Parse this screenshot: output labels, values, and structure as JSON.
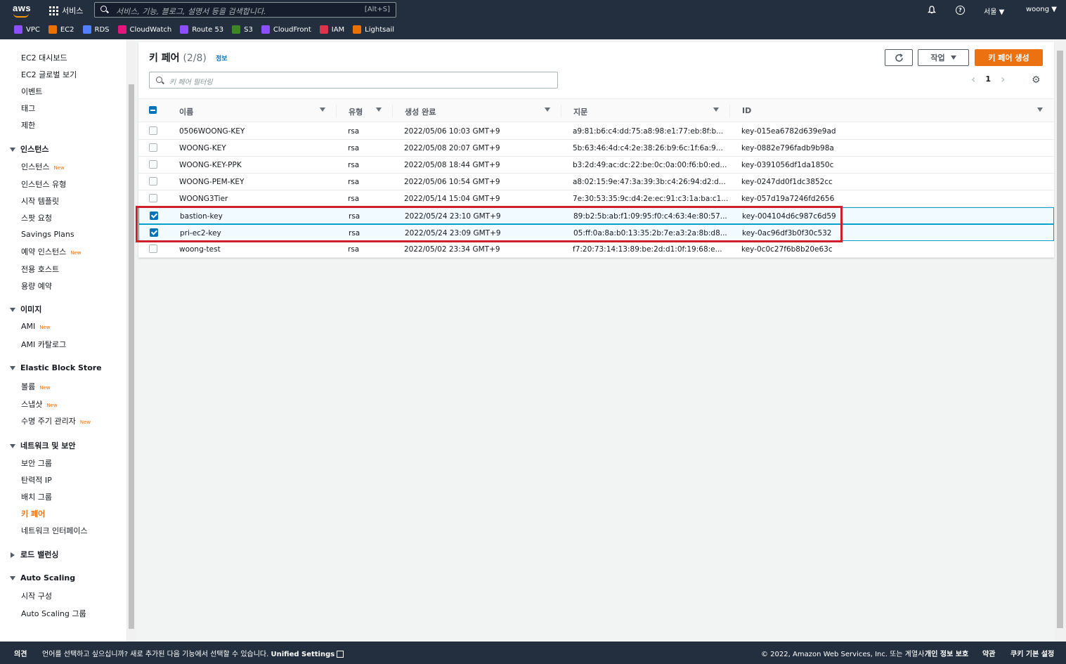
{
  "topnav": {
    "logo": "aws",
    "services_label": "서비스",
    "search_placeholder": "서비스, 기능, 블로그, 설명서 등을 검색합니다.",
    "search_shortcut": "[Alt+S]",
    "region": "서울 ▼",
    "user": "woong ▼"
  },
  "favorites": [
    {
      "label": "VPC",
      "color": "#8c4fff"
    },
    {
      "label": "EC2",
      "color": "#ed7100"
    },
    {
      "label": "RDS",
      "color": "#527fff"
    },
    {
      "label": "CloudWatch",
      "color": "#e7157b"
    },
    {
      "label": "Route 53",
      "color": "#8c4fff"
    },
    {
      "label": "S3",
      "color": "#3f8624"
    },
    {
      "label": "CloudFront",
      "color": "#8c4fff"
    },
    {
      "label": "IAM",
      "color": "#dd344c"
    },
    {
      "label": "Lightsail",
      "color": "#ed7100"
    }
  ],
  "sidebar": {
    "items_top": [
      "EC2 대시보드",
      "EC2 글로벌 보기",
      "이벤트",
      "태그",
      "제한"
    ],
    "instances": {
      "title": "인스턴스",
      "items": [
        {
          "label": "인스턴스",
          "new": "New"
        },
        {
          "label": "인스턴스 유형",
          "new": ""
        },
        {
          "label": "시작 템플릿",
          "new": ""
        },
        {
          "label": "스팟 요청",
          "new": ""
        },
        {
          "label": "Savings Plans",
          "new": ""
        },
        {
          "label": "예약 인스턴스",
          "new": "New"
        },
        {
          "label": "전용 호스트",
          "new": ""
        },
        {
          "label": "용량 예약",
          "new": ""
        }
      ]
    },
    "images": {
      "title": "이미지",
      "items": [
        {
          "label": "AMI",
          "new": "New"
        },
        {
          "label": "AMI 카탈로그",
          "new": ""
        }
      ]
    },
    "ebs": {
      "title": "Elastic Block Store",
      "items": [
        {
          "label": "볼륨",
          "new": "New"
        },
        {
          "label": "스냅샷",
          "new": "New"
        },
        {
          "label": "수명 주기 관리자",
          "new": "New"
        }
      ]
    },
    "network": {
      "title": "네트워크 및 보안",
      "items": [
        {
          "label": "보안 그룹"
        },
        {
          "label": "탄력적 IP"
        },
        {
          "label": "배치 그룹"
        },
        {
          "label": "키 페어"
        },
        {
          "label": "네트워크 인터페이스"
        }
      ]
    },
    "lb": {
      "title": "로드 밸런싱"
    },
    "asg": {
      "title": "Auto Scaling",
      "items": [
        {
          "label": "시작 구성"
        },
        {
          "label": "Auto Scaling 그룹"
        }
      ]
    }
  },
  "panel": {
    "title": "키 페어",
    "count": "(2/8)",
    "info": "정보",
    "action_label": "작업",
    "create_label": "키 페어 생성",
    "filter_placeholder": "키 페어 필터링",
    "page": "1"
  },
  "table": {
    "headers": [
      "이름",
      "유형",
      "생성 완료",
      "지문",
      "ID"
    ],
    "rows": [
      {
        "name": "0506WOONG-KEY",
        "type": "rsa",
        "created": "2022/05/06 10:03 GMT+9",
        "fingerprint": "a9:81:b6:c4:dd:75:a8:98:e1:77:eb:8f:b...",
        "id": "key-015ea6782d639e9ad",
        "selected": false
      },
      {
        "name": "WOONG-KEY",
        "type": "rsa",
        "created": "2022/05/08 20:07 GMT+9",
        "fingerprint": "5b:63:46:4d:c4:2e:38:26:b9:6c:1f:6a:9...",
        "id": "key-0882e796fadb9b98a",
        "selected": false
      },
      {
        "name": "WOONG-KEY-PPK",
        "type": "rsa",
        "created": "2022/05/08 18:44 GMT+9",
        "fingerprint": "b3:2d:49:ac:dc:22:be:0c:0a:00:f6:b0:ed...",
        "id": "key-0391056df1da1850c",
        "selected": false
      },
      {
        "name": "WOONG-PEM-KEY",
        "type": "rsa",
        "created": "2022/05/06 10:54 GMT+9",
        "fingerprint": "a8:02:15:9e:47:3a:39:3b:c4:26:94:d2:d...",
        "id": "key-0247dd0f1dc3852cc",
        "selected": false
      },
      {
        "name": "WOONG3Tier",
        "type": "rsa",
        "created": "2022/05/14 15:04 GMT+9",
        "fingerprint": "7e:30:53:35:9c:d4:2e:ec:91:c3:1a:ba:c1...",
        "id": "key-057d19a7246fd2656",
        "selected": false
      },
      {
        "name": "bastion-key",
        "type": "rsa",
        "created": "2022/05/24 23:10 GMT+9",
        "fingerprint": "89:b2:5b:ab:f1:09:95:f0:c4:63:4e:80:57...",
        "id": "key-004104d6c987c6d59",
        "selected": true
      },
      {
        "name": "pri-ec2-key",
        "type": "rsa",
        "created": "2022/05/24 23:09 GMT+9",
        "fingerprint": "05:ff:0a:8a:b0:13:35:2b:7e:a3:2a:8b:d8...",
        "id": "key-0ac96df3b0f30c532",
        "selected": true
      },
      {
        "name": "woong-test",
        "type": "rsa",
        "created": "2022/05/02 23:34 GMT+9",
        "fingerprint": "f7:20:73:14:13:89:be:2d:d1:0f:19:68:e...",
        "id": "key-0c0c27f6b8b20e63c",
        "selected": false
      }
    ]
  },
  "footer": {
    "feedback": "의견",
    "language_text": "언어를 선택하고 싶으십니까? 새로 추가된 다음 기능에서 선택할 수 있습니다.",
    "unified": "Unified Settings",
    "copyright": "© 2022, Amazon Web Services, Inc. 또는 계열사.",
    "privacy": "개인 정보 보호",
    "terms": "약관",
    "cookies": "쿠키 기본 설정"
  }
}
